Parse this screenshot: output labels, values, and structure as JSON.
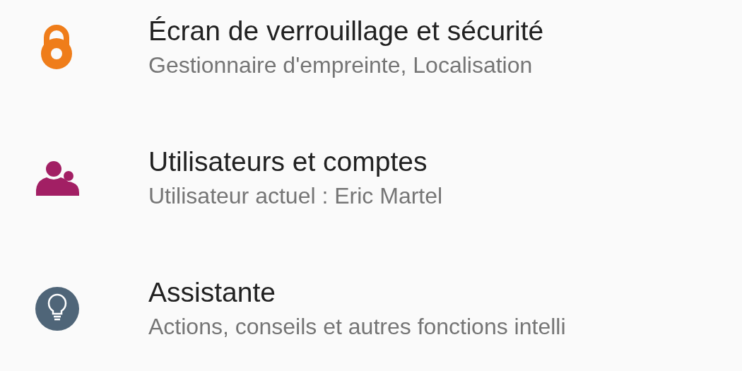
{
  "settings": [
    {
      "kind": "lock",
      "title": "Écran de verrouillage et sécurité",
      "subtitle": "Gestionnaire d'empreinte, Localisation"
    },
    {
      "kind": "users",
      "title": "Utilisateurs et comptes",
      "subtitle": "Utilisateur actuel : Eric Martel"
    },
    {
      "kind": "bulb",
      "title": "Assistante",
      "subtitle": "Actions, conseils et autres fonctions intelli"
    }
  ]
}
